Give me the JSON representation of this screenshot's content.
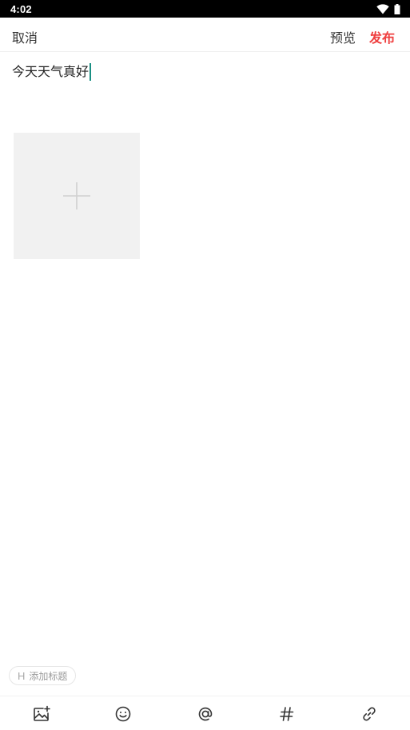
{
  "status_bar": {
    "time": "4:02",
    "icons": [
      "wifi-icon",
      "battery-icon"
    ]
  },
  "header": {
    "cancel_label": "取消",
    "preview_label": "预览",
    "publish_label": "发布",
    "publish_color": "#ef3f3f"
  },
  "editor": {
    "text": "今天天气真好",
    "caret_color": "#1a8f83"
  },
  "image_picker": {
    "icon": "plus-icon"
  },
  "title_chip": {
    "prefix": "H",
    "label": "添加标题"
  },
  "toolbar": {
    "items": [
      "image-add-icon",
      "emoji-icon",
      "mention-icon",
      "hashtag-icon",
      "link-icon"
    ]
  }
}
